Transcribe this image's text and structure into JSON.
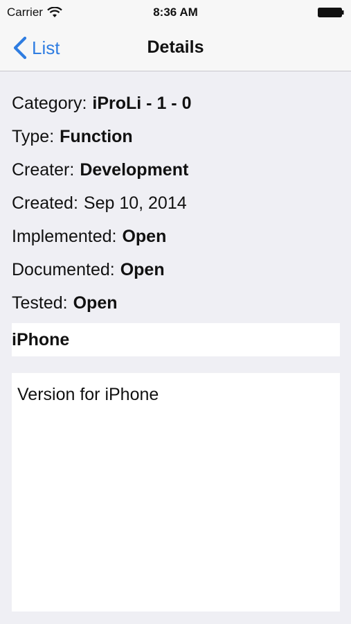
{
  "status_bar": {
    "carrier": "Carrier",
    "time": "8:36 AM",
    "wifi_icon": "wifi-icon",
    "battery_icon": "battery-icon"
  },
  "nav": {
    "back_label": "List",
    "title": "Details",
    "accent_color": "#2f7de1"
  },
  "details": [
    {
      "label": "Category:",
      "value": "iProLi - 1 - 0"
    },
    {
      "label": "Type:",
      "value": "Function"
    },
    {
      "label": "Creater:",
      "value": "Development"
    },
    {
      "label": "Created:",
      "value": "Sep 10, 2014"
    },
    {
      "label": "Implemented:",
      "value": "Open"
    },
    {
      "label": "Documented:",
      "value": "Open"
    },
    {
      "label": "Tested:",
      "value": "Open"
    }
  ],
  "title_field": {
    "value": "iPhone"
  },
  "description": {
    "value": "Version for iPhone"
  }
}
